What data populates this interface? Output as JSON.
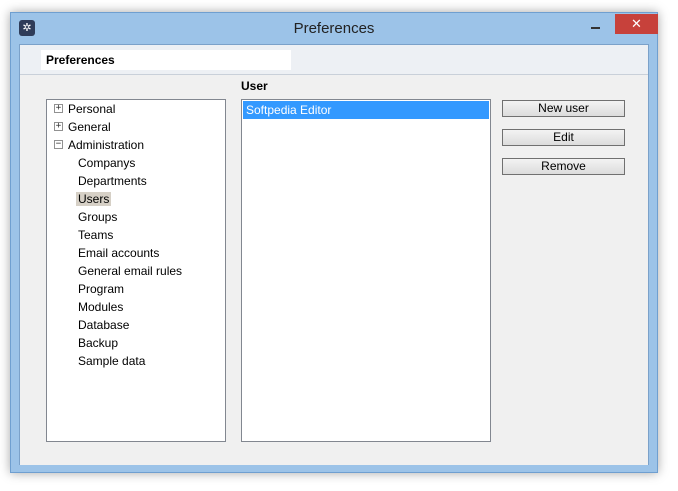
{
  "window": {
    "title": "Preferences"
  },
  "header": {
    "title": "Preferences"
  },
  "tree": {
    "items": [
      {
        "label": "Personal",
        "expander": "+"
      },
      {
        "label": "General",
        "expander": "+"
      },
      {
        "label": "Administration",
        "expander": "−"
      },
      {
        "label": "Companys"
      },
      {
        "label": "Departments"
      },
      {
        "label": "Users",
        "selected": true
      },
      {
        "label": "Groups"
      },
      {
        "label": "Teams"
      },
      {
        "label": "Email accounts"
      },
      {
        "label": "General email rules"
      },
      {
        "label": "Program"
      },
      {
        "label": "Modules"
      },
      {
        "label": "Database"
      },
      {
        "label": "Backup"
      },
      {
        "label": "Sample data"
      }
    ]
  },
  "user_panel": {
    "title": "User",
    "users": [
      "Softpedia Editor"
    ]
  },
  "buttons": {
    "new_user": "New user",
    "edit": "Edit",
    "remove": "Remove"
  },
  "colors": {
    "selection": "#3399ff",
    "close_button": "#c7413b",
    "window_frame": "#9cc3e8"
  }
}
